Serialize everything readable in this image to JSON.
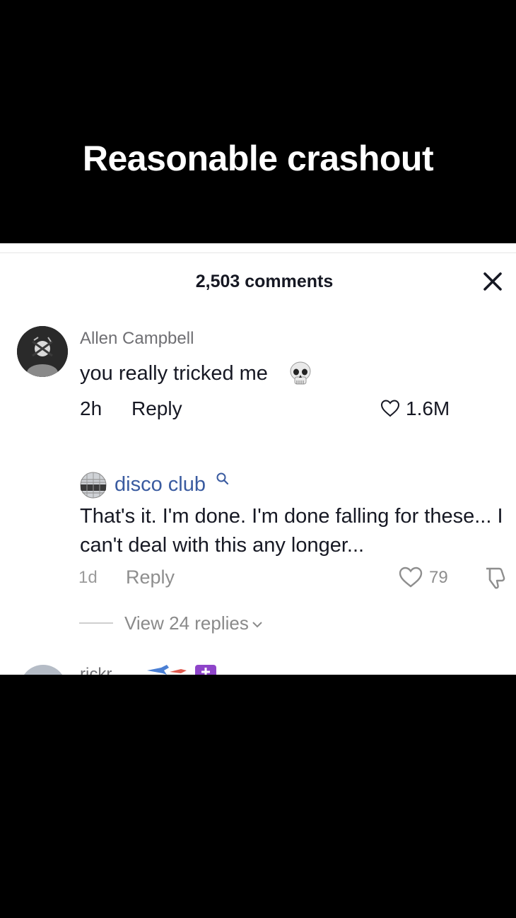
{
  "video": {
    "caption": "Reasonable crashout"
  },
  "comments_panel": {
    "count_label": "2,503 comments",
    "close_icon": "close-icon"
  },
  "comment1": {
    "author": "Allen Campbell",
    "text": "you really tricked me",
    "emoji": "skull-emoji",
    "time": "2h",
    "reply_label": "Reply",
    "likes": "1.6M"
  },
  "comment2": {
    "author": "disco club",
    "text": "That's it. I'm done. I'm done falling for these... I can't deal with this any longer...",
    "time": "1d",
    "reply_label": "Reply",
    "likes": "79",
    "view_replies": "View 24 replies"
  },
  "comment3": {
    "author": "rickr"
  },
  "colors": {
    "background": "#000000",
    "panel": "#ffffff",
    "primary_text": "#161823",
    "secondary_text": "#8e8e8e",
    "link": "#3a5ba0"
  }
}
